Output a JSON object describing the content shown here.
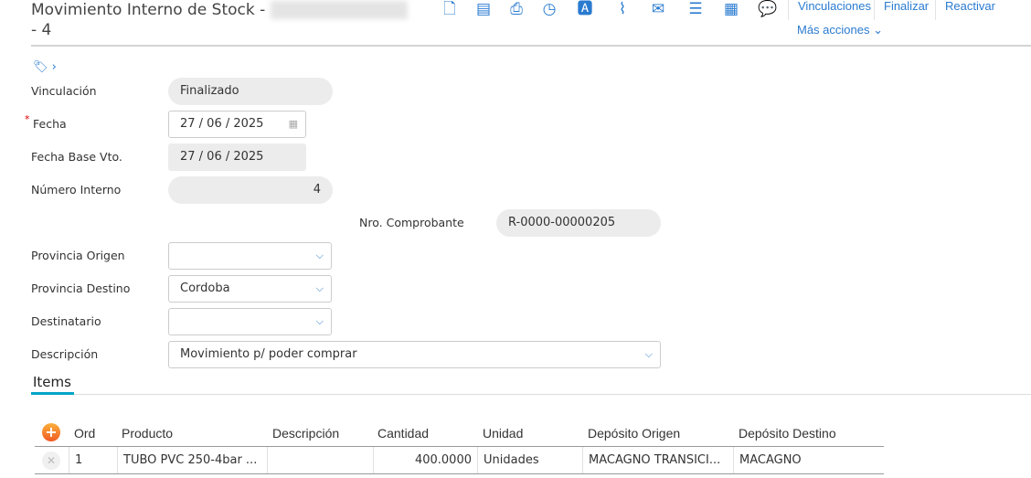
{
  "header": {
    "title": "Movimiento Interno de Stock -",
    "title_suffix": "- 4"
  },
  "toolbar": {
    "icons": [
      "new-document-icon",
      "save-icon",
      "print-icon",
      "history-icon",
      "text-icon",
      "attach-icon",
      "email-icon",
      "list-icon",
      "notes-icon",
      "comment-icon"
    ],
    "actions": [
      "Vinculaciones",
      "Finalizar",
      "Reactivar"
    ],
    "more": "Más acciones"
  },
  "form": {
    "vinculacion": {
      "label": "Vinculación",
      "value": "Finalizado"
    },
    "fecha": {
      "label": "Fecha",
      "value": "27 / 06 / 2025"
    },
    "fecha_base": {
      "label": "Fecha Base Vto.",
      "value": "27 / 06 / 2025"
    },
    "numero": {
      "label": "Número Interno",
      "value": "4"
    },
    "comprobante": {
      "label": "Nro. Comprobante",
      "value": "R-0000-00000205"
    },
    "prov_origen": {
      "label": "Provincia Origen",
      "value": ""
    },
    "prov_destino": {
      "label": "Provincia Destino",
      "value": "Cordoba"
    },
    "destinatario": {
      "label": "Destinatario",
      "value": ""
    },
    "descripcion": {
      "label": "Descripción",
      "value": "Movimiento p/ poder comprar"
    }
  },
  "tabs": {
    "items": "Items"
  },
  "table": {
    "headers": [
      "Ord",
      "Producto",
      "Descripción",
      "Cantidad",
      "Unidad",
      "Depósito Origen",
      "Depósito Destino"
    ],
    "rows": [
      [
        "1",
        "TUBO PVC 250-4bar ...",
        "",
        "400.0000",
        "Unidades",
        "MACAGNO TRANSICI...",
        "MACAGNO"
      ]
    ]
  },
  "colors": {
    "accent": "#2a7bd0",
    "tab": "#00a4c8"
  }
}
